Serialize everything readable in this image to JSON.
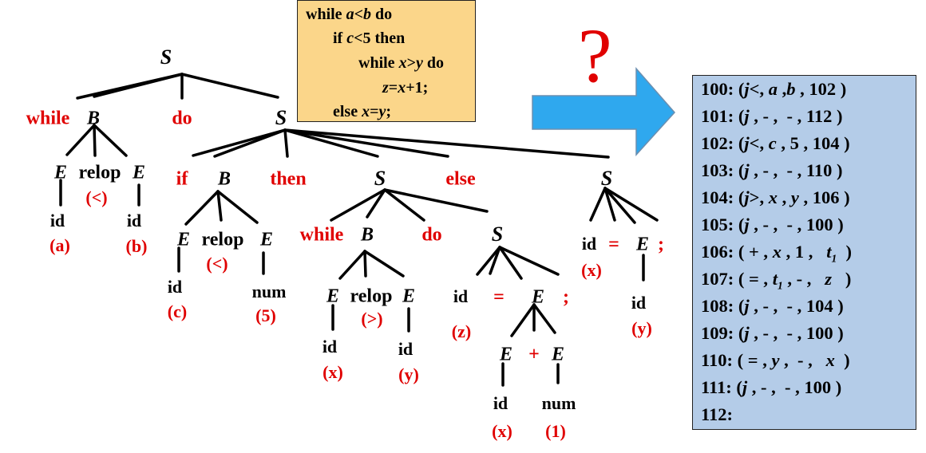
{
  "colors": {
    "keyword_red": "#e00000",
    "code_box_bg": "#fbd68a",
    "quads_box_bg": "#b4cce8",
    "arrow_blue": "#2fa8ee"
  },
  "source_code": [
    {
      "parts": [
        {
          "t": "while "
        },
        {
          "t": "a",
          "i": true
        },
        {
          "t": "<"
        },
        {
          "t": "b",
          "i": true
        },
        {
          "t": " do"
        }
      ]
    },
    {
      "parts": [
        {
          "t": "if "
        },
        {
          "t": "c",
          "i": true
        },
        {
          "t": "<5 then"
        }
      ]
    },
    {
      "parts": [
        {
          "t": "while "
        },
        {
          "t": "x",
          "i": true
        },
        {
          "t": ">"
        },
        {
          "t": "y",
          "i": true
        },
        {
          "t": " do"
        }
      ]
    },
    {
      "parts": [
        {
          "t": "z",
          "i": true
        },
        {
          "t": "="
        },
        {
          "t": "x",
          "i": true
        },
        {
          "t": "+1;"
        }
      ]
    },
    {
      "parts": [
        {
          "t": "else "
        },
        {
          "t": "x",
          "i": true
        },
        {
          "t": "="
        },
        {
          "t": "y",
          "i": true
        },
        {
          "t": ";"
        }
      ]
    }
  ],
  "question_mark": "?",
  "arrow_icon": "right-arrow-icon",
  "quadruples": [
    {
      "parts": [
        {
          "t": "100: ("
        },
        {
          "t": "j",
          "i": true
        },
        {
          "t": "<, "
        },
        {
          "t": "a",
          "i": true
        },
        {
          "t": " ,"
        },
        {
          "t": "b",
          "i": true
        },
        {
          "t": " , 102 )"
        }
      ]
    },
    {
      "parts": [
        {
          "t": "101: ("
        },
        {
          "t": "j",
          "i": true
        },
        {
          "t": " , - ,  - , 112 )"
        }
      ]
    },
    {
      "parts": [
        {
          "t": "102: ("
        },
        {
          "t": "j",
          "i": true
        },
        {
          "t": "<, "
        },
        {
          "t": "c",
          "i": true
        },
        {
          "t": " , 5 , 104 )"
        }
      ]
    },
    {
      "parts": [
        {
          "t": "103: ("
        },
        {
          "t": "j",
          "i": true
        },
        {
          "t": " , - ,  - , 110 )"
        }
      ]
    },
    {
      "parts": [
        {
          "t": "104: ("
        },
        {
          "t": "j",
          "i": true
        },
        {
          "t": ">, "
        },
        {
          "t": "x",
          "i": true
        },
        {
          "t": " , "
        },
        {
          "t": "y",
          "i": true
        },
        {
          "t": " , 106 )"
        }
      ]
    },
    {
      "parts": [
        {
          "t": "105: ("
        },
        {
          "t": "j",
          "i": true
        },
        {
          "t": " , - ,  - , 100 )"
        }
      ]
    },
    {
      "parts": [
        {
          "t": "106: ( + , "
        },
        {
          "t": "x",
          "i": true
        },
        {
          "t": " , 1 ,   "
        },
        {
          "t": "t",
          "i": true
        },
        {
          "t": "1",
          "sub": true
        },
        {
          "t": "  )"
        }
      ]
    },
    {
      "parts": [
        {
          "t": "107: ( = , "
        },
        {
          "t": "t",
          "i": true
        },
        {
          "t": "1",
          "sub": true
        },
        {
          "t": " , - ,   "
        },
        {
          "t": "z",
          "i": true
        },
        {
          "t": "   )"
        }
      ]
    },
    {
      "parts": [
        {
          "t": "108: ("
        },
        {
          "t": "j",
          "i": true
        },
        {
          "t": " , - ,  - , 104 )"
        }
      ]
    },
    {
      "parts": [
        {
          "t": "109: ("
        },
        {
          "t": "j",
          "i": true
        },
        {
          "t": " , - ,  - , 100 )"
        }
      ]
    },
    {
      "parts": [
        {
          "t": "110: ( = , "
        },
        {
          "t": "y",
          "i": true
        },
        {
          "t": " ,  - ,   "
        },
        {
          "t": "x",
          "i": true
        },
        {
          "t": "  )"
        }
      ]
    },
    {
      "parts": [
        {
          "t": "111: ("
        },
        {
          "t": "j",
          "i": true
        },
        {
          "t": " , - ,  - , 100 )"
        }
      ]
    },
    {
      "parts": [
        {
          "t": "112:"
        }
      ]
    }
  ],
  "parse_tree": {
    "nodes": {
      "root": {
        "text": "S",
        "italic": true
      },
      "w1": {
        "text": "while",
        "red": true
      },
      "B1": {
        "text": "B",
        "italic": true
      },
      "do1": {
        "text": "do",
        "red": true
      },
      "S1": {
        "text": "S",
        "italic": true
      },
      "E1": {
        "text": "E",
        "italic": true
      },
      "relop1": {
        "text": "relop"
      },
      "E2": {
        "text": "E",
        "italic": true
      },
      "lt1": {
        "text": "(<)",
        "red": true
      },
      "id_a": {
        "text": "id"
      },
      "a": {
        "text": "(a)",
        "red": true
      },
      "id_b": {
        "text": "id"
      },
      "b": {
        "text": "(b)",
        "red": true
      },
      "if": {
        "text": "if",
        "red": true
      },
      "B2": {
        "text": "B",
        "italic": true
      },
      "then": {
        "text": "then",
        "red": true
      },
      "S2": {
        "text": "S",
        "italic": true
      },
      "else": {
        "text": "else",
        "red": true
      },
      "S3": {
        "text": "S",
        "italic": true
      },
      "E3": {
        "text": "E",
        "italic": true
      },
      "relop2": {
        "text": "relop"
      },
      "E4": {
        "text": "E",
        "italic": true
      },
      "lt2": {
        "text": "(<)",
        "red": true
      },
      "id_c": {
        "text": "id"
      },
      "c": {
        "text": "(c)",
        "red": true
      },
      "num5": {
        "text": "num"
      },
      "five": {
        "text": "(5)",
        "red": true
      },
      "w2": {
        "text": "while",
        "red": true
      },
      "B3": {
        "text": "B",
        "italic": true
      },
      "do2": {
        "text": "do",
        "red": true
      },
      "S4": {
        "text": "S",
        "italic": true
      },
      "E5": {
        "text": "E",
        "italic": true
      },
      "relop3": {
        "text": "relop"
      },
      "E6": {
        "text": "E",
        "italic": true
      },
      "gt": {
        "text": "(>)",
        "red": true
      },
      "id_x1": {
        "text": "id"
      },
      "x1": {
        "text": "(x)",
        "red": true
      },
      "id_y1": {
        "text": "id"
      },
      "y1": {
        "text": "(y)",
        "red": true
      },
      "id_z": {
        "text": "id"
      },
      "z": {
        "text": "(z)",
        "red": true
      },
      "eq1": {
        "text": "=",
        "red": true
      },
      "E7": {
        "text": "E",
        "italic": true
      },
      "semi1": {
        "text": ";",
        "red": true
      },
      "E8": {
        "text": "E",
        "italic": true
      },
      "plus": {
        "text": "+",
        "red": true
      },
      "E9": {
        "text": "E",
        "italic": true
      },
      "id_x2": {
        "text": "id"
      },
      "x2": {
        "text": "(x)",
        "red": true
      },
      "num1": {
        "text": "num"
      },
      "one": {
        "text": "(1)",
        "red": true
      },
      "id_x3": {
        "text": "id"
      },
      "x3": {
        "text": "(x)",
        "red": true
      },
      "eq2": {
        "text": "=",
        "red": true
      },
      "E10": {
        "text": "E",
        "italic": true
      },
      "semi2": {
        "text": ";",
        "red": true
      },
      "id_y2": {
        "text": "id"
      },
      "y2": {
        "text": "(y)",
        "red": true
      }
    }
  }
}
